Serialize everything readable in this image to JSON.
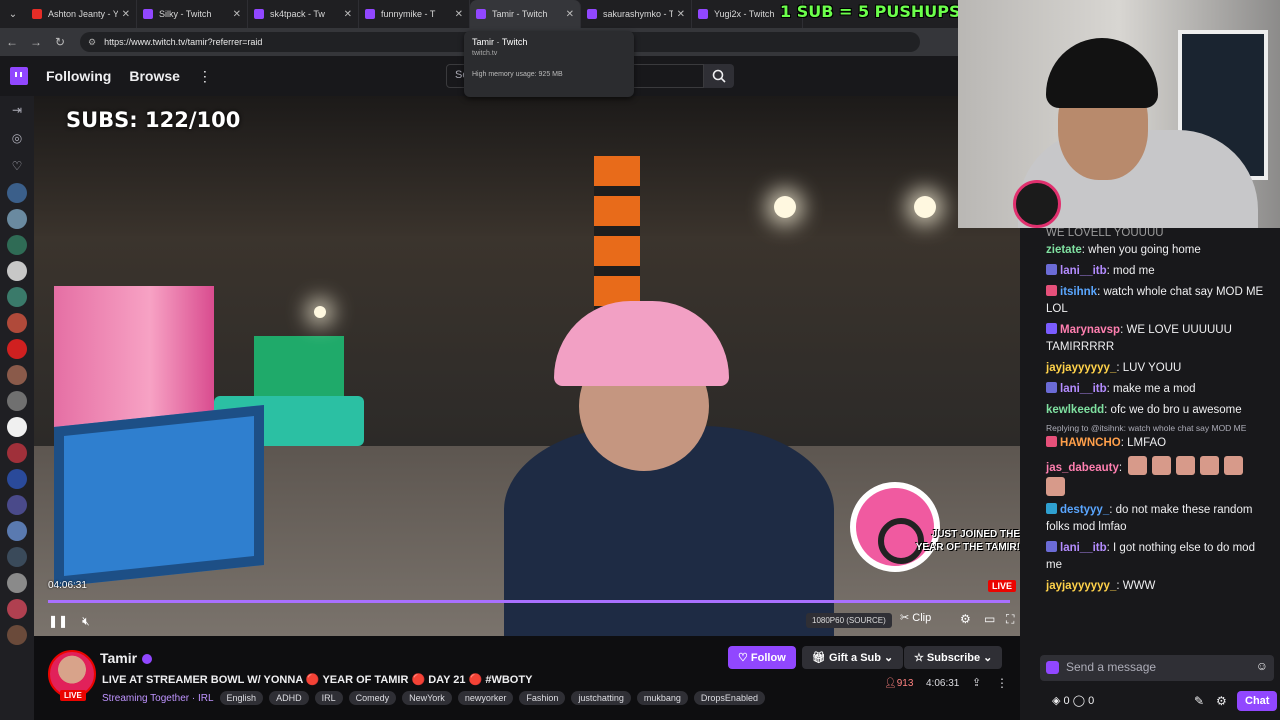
{
  "browser": {
    "tabs": [
      {
        "label": "Ashton Jeanty - Y",
        "color": "#e52d27"
      },
      {
        "label": "Silky - Twitch",
        "color": "#9147ff"
      },
      {
        "label": "sk4tpack - Tw",
        "color": "#9147ff"
      },
      {
        "label": "funnymike - T",
        "color": "#9147ff"
      },
      {
        "label": "Tamir - Twitch",
        "color": "#9147ff",
        "active": true
      },
      {
        "label": "sakurashymko - T",
        "color": "#9147ff"
      },
      {
        "label": "Yugi2x - Twitch",
        "color": "#9147ff"
      }
    ],
    "url": "https://www.twitch.tv/tamir?referrer=raid",
    "tooltip": {
      "title": "Tamir · Twitch",
      "domain": "twitch.tv",
      "memory": "High memory usage: 925 MB"
    }
  },
  "overlay_banner": "1 SUB = 5 PUSHUPS",
  "topnav": {
    "following": "Following",
    "browse": "Browse",
    "search_placeholder": "Se"
  },
  "video": {
    "subs_counter": "SUBS: 122/100",
    "alert_line1": "JUST JOINED THE",
    "alert_line2": "YEAR OF THE TAMIR!",
    "elapsed": "04:06:31",
    "live": "LIVE",
    "progress": 1.0,
    "quality": "1080P60 (SOURCE)",
    "clip": "Clip"
  },
  "channel": {
    "name": "Tamir",
    "live": "LIVE",
    "title": "LIVE AT STREAMER BOWL W/ YONNA 🔴 YEAR OF TAMIR 🔴 DAY 21 🔴 #WBOTY",
    "meta": "Streaming Together · IRL",
    "tags": [
      "English",
      "ADHD",
      "IRL",
      "Comedy",
      "NewYork",
      "newyorker",
      "Fashion",
      "justchatting",
      "mukbang",
      "DropsEnabled"
    ],
    "follow": "Follow",
    "gift": "Gift a Sub",
    "subscribe": "Subscribe",
    "viewers": "913",
    "uptime": "4:06:31"
  },
  "chat": {
    "top_partial": "WE LOVELL YOUUUU",
    "messages": [
      {
        "user": "zietate",
        "color": "#7fe0a0",
        "text": ": when you going home",
        "badge": ""
      },
      {
        "user": "lani__itb",
        "color": "#b48cff",
        "text": ": mod me",
        "badge": "#6b6bd6"
      },
      {
        "user": "itsihnk",
        "color": "#5aa6ff",
        "text": ": watch whole chat say MOD ME LOL",
        "badge": "#e6507a"
      },
      {
        "user": "Marynavsp",
        "color": "#ff7fb0",
        "text": ": WE LOVE UUUUUU TAMIRRRRR",
        "badge": "#7a5cff"
      },
      {
        "user": "jayjayyyyyy_",
        "color": "#ffd24a",
        "text": ": LUV YOUU",
        "badge": ""
      },
      {
        "user": "lani__itb",
        "color": "#b48cff",
        "text": ": make me a mod",
        "badge": "#6b6bd6"
      },
      {
        "user": "kewlkeedd",
        "color": "#7fe0a0",
        "text": ": ofc we do bro u awesome",
        "badge": ""
      }
    ],
    "reply_note": "Replying to @itsihnk: watch whole chat say MOD ME",
    "messages2": [
      {
        "user": "HAWNCHO",
        "color": "#ff9f4a",
        "text": ": LMFAO",
        "badge": "#e6507a"
      },
      {
        "user": "jas_dabeauty",
        "color": "#ff7fb0",
        "text": ":",
        "badge": ""
      },
      {
        "user": "destyyy_",
        "color": "#5aa6ff",
        "text": ": do not make these random folks mod lmfao",
        "badge": "#2fa0d0"
      },
      {
        "user": "lani__itb",
        "color": "#b48cff",
        "text": ": I got nothing else to do mod me",
        "badge": "#6b6bd6"
      },
      {
        "user": "jayjayyyyyy_",
        "color": "#ffd24a",
        "text": ": WWW",
        "badge": ""
      }
    ],
    "input_placeholder": "Send a message",
    "points_a": "0",
    "points_b": "0",
    "chat_button": "Chat"
  }
}
